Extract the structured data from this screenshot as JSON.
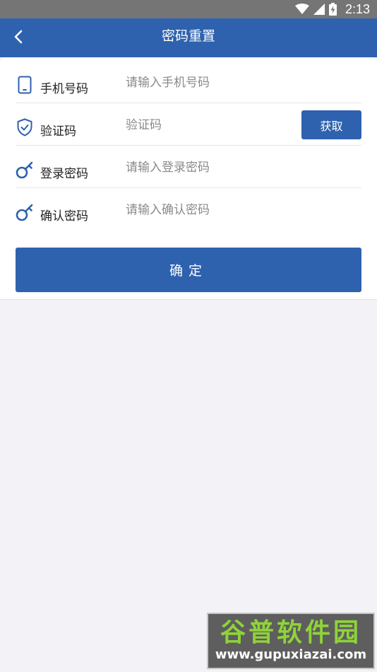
{
  "status_bar": {
    "time": "2:13",
    "icons": [
      "wifi-icon",
      "signal-icon",
      "battery-charging-icon"
    ]
  },
  "app_bar": {
    "title": "密码重置",
    "back_icon": "chevron-left-icon"
  },
  "form": {
    "rows": [
      {
        "icon": "phone-icon",
        "label": "手机号码",
        "placeholder": "请输入手机号码",
        "value": ""
      },
      {
        "icon": "shield-check-icon",
        "label": "验证码",
        "placeholder": "验证码",
        "value": "",
        "action_label": "获取"
      },
      {
        "icon": "key-icon",
        "label": "登录密码",
        "placeholder": "请输入登录密码",
        "value": ""
      },
      {
        "icon": "key-icon",
        "label": "确认密码",
        "placeholder": "请输入确认密码",
        "value": ""
      }
    ],
    "confirm_label": "确定"
  },
  "watermark": {
    "title": "谷普软件园",
    "url": "www.gupuxiazai.com"
  },
  "colors": {
    "primary": "#2e62ae",
    "status_bar": "#757575",
    "background": "#f2f2f7",
    "watermark_green": "#8fd33a"
  }
}
